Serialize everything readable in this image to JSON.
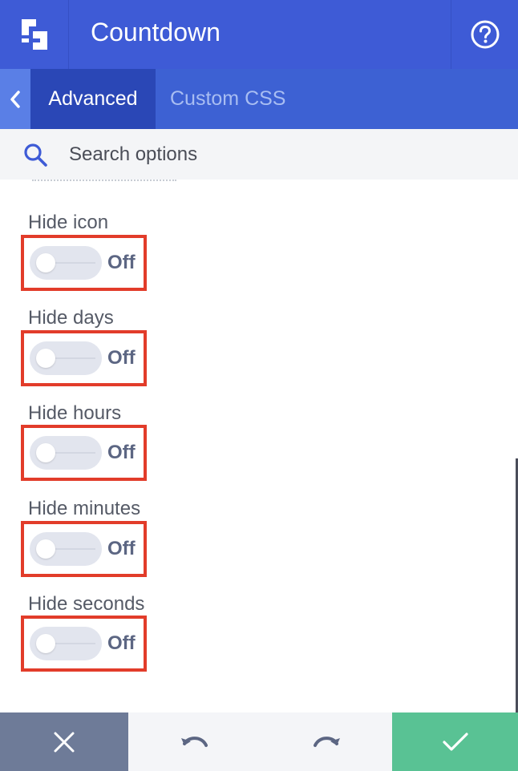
{
  "header": {
    "title": "Countdown",
    "logo_icon": "builder-logo-icon",
    "help_icon": "help-circle-icon",
    "color": "#3e5bd6"
  },
  "tabs": {
    "back_icon": "chevron-left-icon",
    "items": [
      {
        "label": "Advanced",
        "active": true
      },
      {
        "label": "Custom CSS",
        "active": false
      }
    ]
  },
  "search": {
    "placeholder": "Search options",
    "icon": "search-icon"
  },
  "options": [
    {
      "label": "Hide icon",
      "state": "Off"
    },
    {
      "label": "Hide days",
      "state": "Off"
    },
    {
      "label": "Hide hours",
      "state": "Off"
    },
    {
      "label": "Hide minutes",
      "state": "Off"
    },
    {
      "label": "Hide seconds",
      "state": "Off"
    }
  ],
  "footer": {
    "cancel_icon": "close-icon",
    "undo_icon": "undo-icon",
    "redo_icon": "redo-icon",
    "save_icon": "checkmark-icon",
    "save_color": "#59c294"
  },
  "highlight_color": "#e23c2a"
}
